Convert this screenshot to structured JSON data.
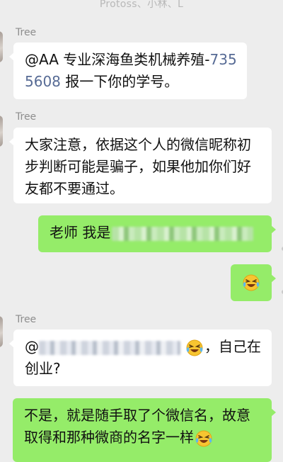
{
  "header": {
    "names": "Protoss、小林、L"
  },
  "messages": [
    {
      "sender": "Tree",
      "mention": "@AA",
      "text_before_phone": " 专业深海鱼类机械养殖-",
      "phone": "7355608",
      "text_after_phone": " 报一下你的学号。"
    },
    {
      "sender": "Tree",
      "text": "大家注意，依据这个人的微信昵称初步判断可能是骗子，如果他加你们好友都不要通过。"
    },
    {
      "text_prefix": "老师 我是"
    },
    {
      "emoji": "laughing-crying-icon"
    },
    {
      "sender": "Tree",
      "mention": "@",
      "text_after": "，自己在创业?"
    },
    {
      "text": "不是，就是随手取了个微信名，故意取得和那种微商的名字一样"
    }
  ],
  "colors": {
    "background": "#ededed",
    "incoming_bubble": "#ffffff",
    "outgoing_bubble": "#95ec69",
    "phone_link": "#576b95"
  }
}
